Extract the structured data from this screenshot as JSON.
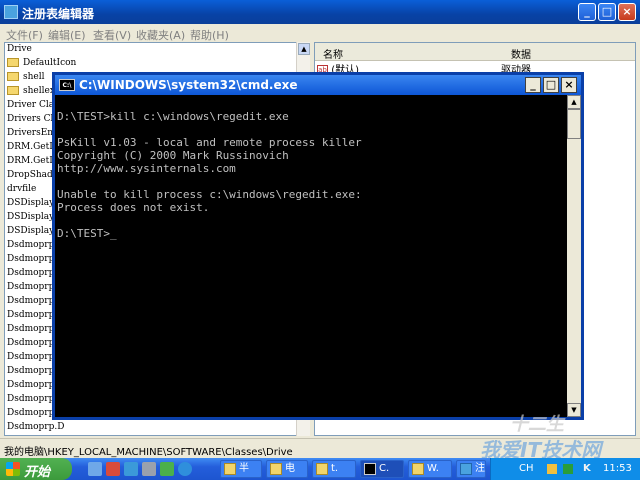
{
  "regedit": {
    "title": "注册表编辑器",
    "menu": [
      "文件(F)",
      "编辑(E)",
      "查看(V)",
      "收藏夹(A)",
      "帮助(H)"
    ],
    "tree_items": [
      {
        "label": "Drive",
        "folder": false
      },
      {
        "label": "DefaultIcon",
        "folder": true
      },
      {
        "label": "shell",
        "folder": true
      },
      {
        "label": "shellex",
        "folder": true
      },
      {
        "label": "Driver Cla",
        "folder": false
      },
      {
        "label": "Drivers Cl",
        "folder": false
      },
      {
        "label": "DriversEnv",
        "folder": false
      },
      {
        "label": "DRM.GetLic",
        "folder": false
      },
      {
        "label": "DRM.GetLic",
        "folder": false
      },
      {
        "label": "DropShadow",
        "folder": false
      },
      {
        "label": "drvfile",
        "folder": false
      },
      {
        "label": "DSDisplayP",
        "folder": false
      },
      {
        "label": "DSDisplayP",
        "folder": false
      },
      {
        "label": "DSDisplayP",
        "folder": false
      },
      {
        "label": "Dsdmoprp.D",
        "folder": false
      },
      {
        "label": "Dsdmoprp.D",
        "folder": false
      },
      {
        "label": "Dsdmoprp.D",
        "folder": false
      },
      {
        "label": "Dsdmoprp.D",
        "folder": false
      },
      {
        "label": "Dsdmoprp.D",
        "folder": false
      },
      {
        "label": "Dsdmoprp.D",
        "folder": false
      },
      {
        "label": "Dsdmoprp.D",
        "folder": false
      },
      {
        "label": "Dsdmoprp.D",
        "folder": false
      },
      {
        "label": "Dsdmoprp.D",
        "folder": false
      },
      {
        "label": "Dsdmoprp.D",
        "folder": false
      },
      {
        "label": "Dsdmoprp.D",
        "folder": false
      },
      {
        "label": "Dsdmoprp.D",
        "folder": false
      },
      {
        "label": "Dsdmoprp.D",
        "folder": false
      },
      {
        "label": "Dsdmoprp.D",
        "folder": false
      }
    ],
    "list_headers": {
      "name": "名称",
      "data": "数据"
    },
    "list_row": {
      "name": "(默认)",
      "data": "驱动器"
    },
    "status": "我的电脑\\HKEY_LOCAL_MACHINE\\SOFTWARE\\Classes\\Drive"
  },
  "cmd": {
    "title": "C:\\WINDOWS\\system32\\cmd.exe",
    "lines": [
      "",
      "D:\\TEST>kill c:\\windows\\regedit.exe",
      "",
      "PsKill v1.03 - local and remote process killer",
      "Copyright (C) 2000 Mark Russinovich",
      "http://www.sysinternals.com",
      "",
      "Unable to kill process c:\\windows\\regedit.exe:",
      "Process does not exist.",
      "",
      "D:\\TEST>_"
    ]
  },
  "taskbar": {
    "start_label": "开始",
    "tasks": [
      {
        "label": "半"
      },
      {
        "label": "电"
      },
      {
        "label": "t."
      },
      {
        "label": "C."
      },
      {
        "label": "W."
      },
      {
        "label": "注"
      }
    ],
    "tray": {
      "ime": "CH",
      "clock": "11:53"
    }
  },
  "watermark": {
    "text": "我爱IT技术网",
    "sub": "十二生"
  },
  "colors": {
    "titlebar": "#0a5fd8",
    "console_bg": "#000000",
    "console_fg": "#c0c0c0",
    "taskbar": "#245edb",
    "start": "#3c9a3c"
  }
}
